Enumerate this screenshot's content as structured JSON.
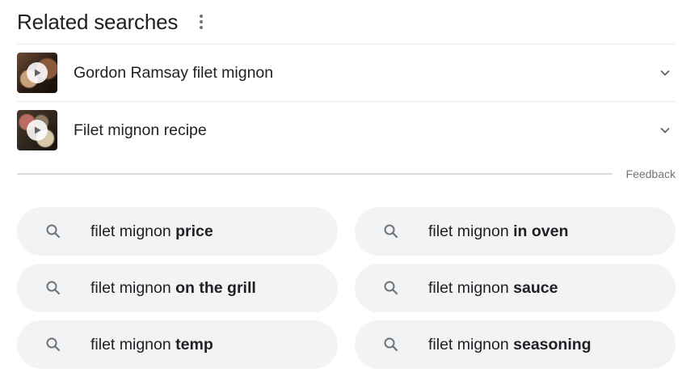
{
  "header": {
    "title": "Related searches",
    "menu_icon": "more-vert-icon"
  },
  "related_items": [
    {
      "label": "Gordon Ramsay filet mignon",
      "thumb_icon": "play-icon",
      "expand_icon": "chevron-down-icon"
    },
    {
      "label": "Filet mignon recipe",
      "thumb_icon": "play-icon",
      "expand_icon": "chevron-down-icon"
    }
  ],
  "feedback": {
    "label": "Feedback"
  },
  "suggestions": [
    {
      "prefix": "filet mignon ",
      "bold": "price"
    },
    {
      "prefix": "filet mignon ",
      "bold": "in oven"
    },
    {
      "prefix": "filet mignon ",
      "bold": "on the grill"
    },
    {
      "prefix": "filet mignon ",
      "bold": "sauce"
    },
    {
      "prefix": "filet mignon ",
      "bold": "temp"
    },
    {
      "prefix": "filet mignon ",
      "bold": "seasoning"
    }
  ],
  "colors": {
    "text": "#202124",
    "muted": "#70757a",
    "chip_bg": "#f1f3f4",
    "divider": "#dadce0",
    "icon": "#70757a"
  }
}
